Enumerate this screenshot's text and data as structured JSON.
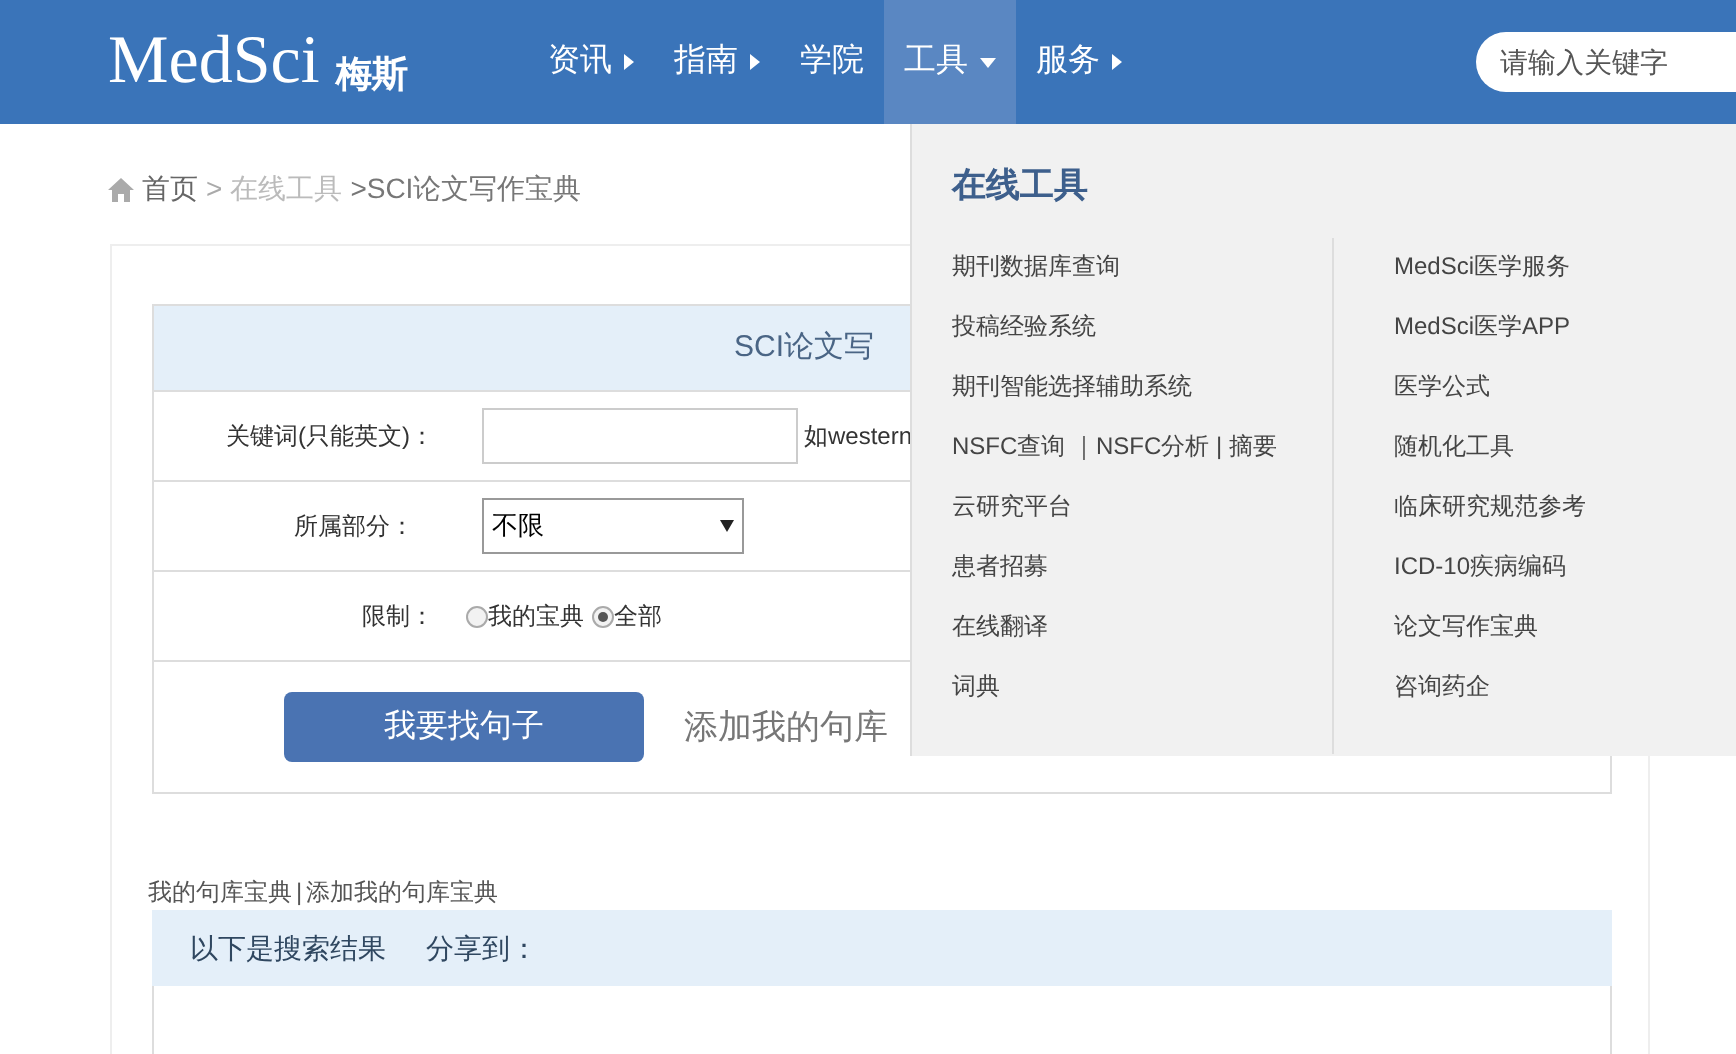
{
  "header": {
    "logo": "MedSci",
    "logo_sub": "梅斯",
    "nav": [
      {
        "label": "资讯",
        "kind": "submenu",
        "selected": false
      },
      {
        "label": "指南",
        "kind": "submenu",
        "selected": false
      },
      {
        "label": "学院",
        "kind": "plain",
        "selected": false
      },
      {
        "label": "工具",
        "kind": "dropdown",
        "selected": true
      },
      {
        "label": "服务",
        "kind": "submenu",
        "selected": false
      }
    ],
    "search": {
      "placeholder": "请输入关键字"
    }
  },
  "breadcrumb": [
    "首页",
    ">",
    "在线工具",
    ">SCI论文写作宝典"
  ],
  "form": {
    "title": "SCI论文写",
    "keyword_label": "关键词(只能英文)：",
    "keyword_hint": "如western",
    "section_label": "所属部分：",
    "section_value": "不限",
    "limit_label": "限制：",
    "limit_options": [
      {
        "label": "我的宝典",
        "selected": false
      },
      {
        "label": "全部",
        "selected": true
      }
    ],
    "search_button": "我要找句子",
    "add_link": "添加我的句库"
  },
  "links": [
    "我的句库宝典",
    "|",
    "添加我的句库宝典"
  ],
  "results": {
    "title": "以下是搜索结果",
    "share": "分享到："
  },
  "dropdown": {
    "title": "在线工具",
    "left": [
      "期刊数据库查询",
      "投稿经验系统",
      "期刊智能选择辅助系统",
      "NSFC查询 ｜NSFC分析 | 摘要",
      "云研究平台",
      "患者招募",
      "在线翻译",
      "词典"
    ],
    "right": [
      "MedSci医学服务",
      "MedSci医学APP",
      "医学公式",
      "随机化工具",
      "临床研究规范参考",
      "ICD-10疾病编码",
      "论文写作宝典",
      "咨询药企"
    ]
  }
}
